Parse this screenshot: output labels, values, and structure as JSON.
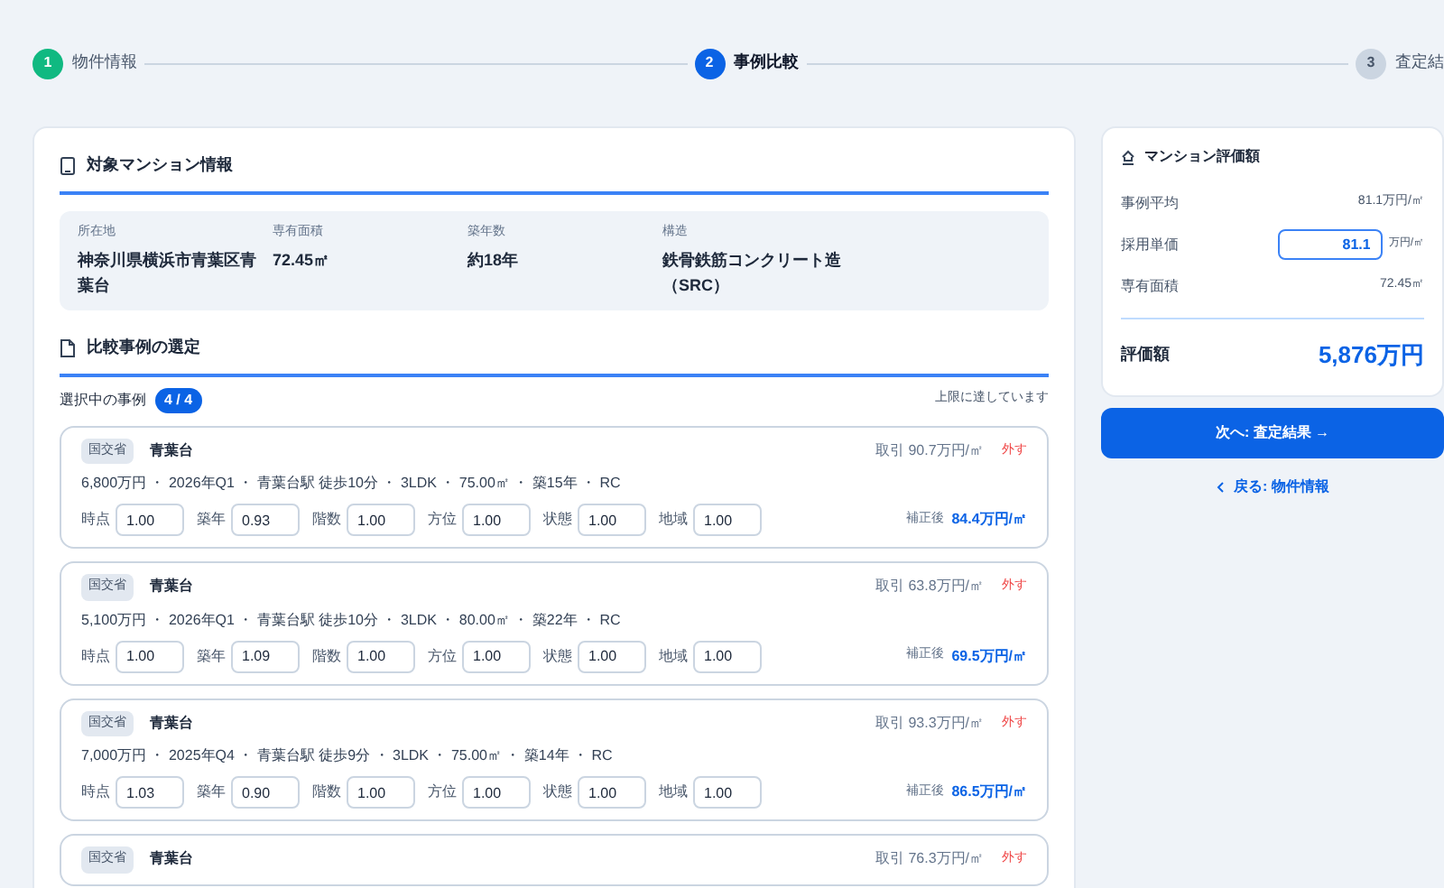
{
  "stepper": [
    {
      "number": "1",
      "label": "物件情報",
      "completed": true,
      "selected": false
    },
    {
      "number": "2",
      "label": "事例比較",
      "completed": false,
      "selected": true
    },
    {
      "number": "3",
      "label": "査定結",
      "completed": false,
      "selected": false
    }
  ],
  "subject": {
    "title": "対象マンション情報",
    "fields": [
      {
        "label": "所在地",
        "value": "神奈川県横浜市青葉区青葉台"
      },
      {
        "label": "専有面積",
        "value": "72.45㎡"
      },
      {
        "label": "築年数",
        "value": "約18年"
      },
      {
        "label": "構造",
        "value": "鉄骨鉄筋コンクリート造（SRC）"
      }
    ]
  },
  "comparables": {
    "title": "比較事例の選定",
    "selected_label": "選択中の事例",
    "count": "4 / 4",
    "limit_note": "上限に達しています",
    "cases": [
      {
        "source": "国交省",
        "name": "青葉台",
        "price_per_sqm": "取引 90.7万円/㎡",
        "remove": "外す",
        "details": "6,800万円 ・ 2026年Q1 ・ 青葉台駅 徒歩10分 ・ 3LDK ・ 75.00㎡ ・ 築15年 ・ RC",
        "factors": [
          {
            "label": "時点",
            "value": "1.00"
          },
          {
            "label": "築年",
            "value": "0.93"
          },
          {
            "label": "階数",
            "value": "1.00"
          },
          {
            "label": "方位",
            "value": "1.00"
          },
          {
            "label": "状態",
            "value": "1.00"
          },
          {
            "label": "地域",
            "value": "1.00"
          }
        ],
        "adjusted_label": "補正後",
        "adjusted": "84.4万円/㎡"
      },
      {
        "source": "国交省",
        "name": "青葉台",
        "price_per_sqm": "取引 63.8万円/㎡",
        "remove": "外す",
        "details": "5,100万円 ・ 2026年Q1 ・ 青葉台駅 徒歩10分 ・ 3LDK ・ 80.00㎡ ・ 築22年 ・ RC",
        "factors": [
          {
            "label": "時点",
            "value": "1.00"
          },
          {
            "label": "築年",
            "value": "1.09"
          },
          {
            "label": "階数",
            "value": "1.00"
          },
          {
            "label": "方位",
            "value": "1.00"
          },
          {
            "label": "状態",
            "value": "1.00"
          },
          {
            "label": "地域",
            "value": "1.00"
          }
        ],
        "adjusted_label": "補正後",
        "adjusted": "69.5万円/㎡"
      },
      {
        "source": "国交省",
        "name": "青葉台",
        "price_per_sqm": "取引 93.3万円/㎡",
        "remove": "外す",
        "details": "7,000万円 ・ 2025年Q4 ・ 青葉台駅 徒歩9分 ・ 3LDK ・ 75.00㎡ ・ 築14年 ・ RC",
        "factors": [
          {
            "label": "時点",
            "value": "1.03"
          },
          {
            "label": "築年",
            "value": "0.90"
          },
          {
            "label": "階数",
            "value": "1.00"
          },
          {
            "label": "方位",
            "value": "1.00"
          },
          {
            "label": "状態",
            "value": "1.00"
          },
          {
            "label": "地域",
            "value": "1.00"
          }
        ],
        "adjusted_label": "補正後",
        "adjusted": "86.5万円/㎡"
      },
      {
        "source": "国交省",
        "name": "青葉台",
        "price_per_sqm": "取引 76.3万円/㎡",
        "remove": "外す"
      }
    ]
  },
  "valuation": {
    "title": "マンション評価額",
    "average_label": "事例平均",
    "average": "81.1万円/㎡",
    "unit_price_label": "採用単価",
    "unit_price": "81.1",
    "unit_price_unit": "万円/㎡",
    "area_label": "専有面積",
    "area": "72.45㎡",
    "total_label": "評価額",
    "total": "5,876万円"
  },
  "next_button": "次へ: 査定結果 →",
  "back_link": "戻る: 物件情報"
}
